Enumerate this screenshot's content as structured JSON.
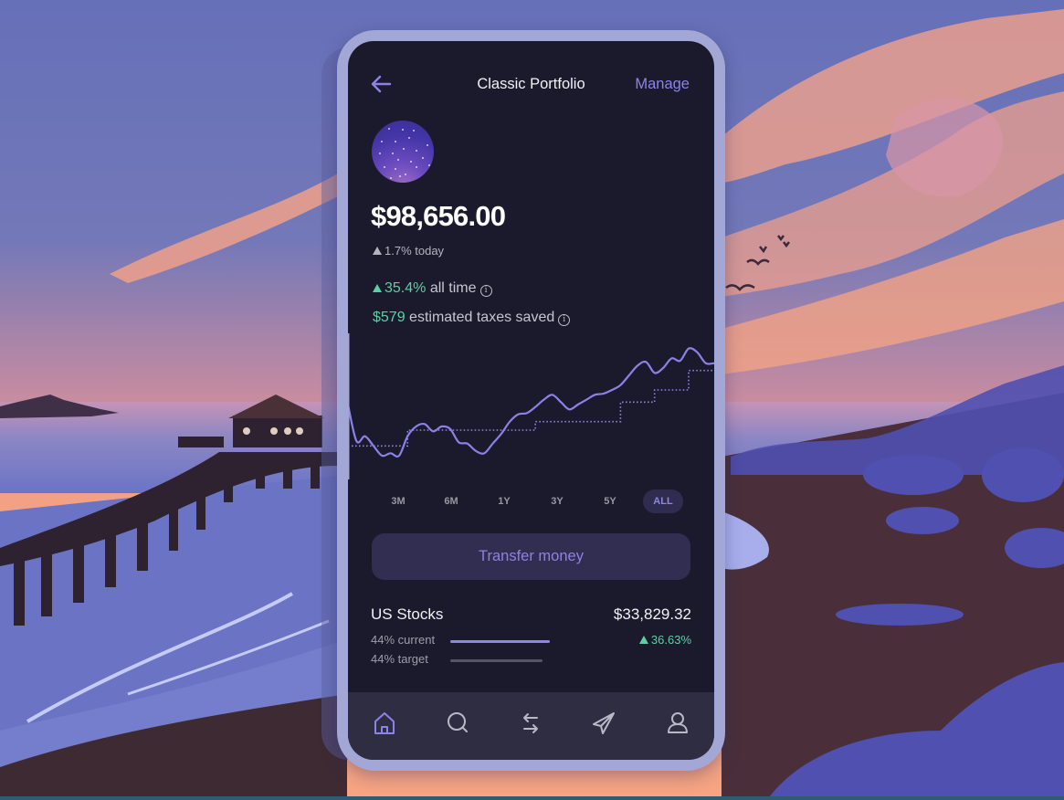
{
  "header": {
    "back_icon": "arrow-left-icon",
    "title": "Classic Portfolio",
    "manage_label": "Manage"
  },
  "portfolio": {
    "avatar": "starry-sky-avatar",
    "balance": "$98,656.00",
    "today_change": "1.7% today",
    "all_time_value": "35.4%",
    "all_time_label": "all time",
    "taxes_value": "$579",
    "taxes_label": "estimated taxes saved",
    "info_icon_glyph": "i"
  },
  "chart_data": {
    "type": "line",
    "title": "",
    "xlabel": "",
    "ylabel": "",
    "grid": false,
    "series": [
      {
        "name": "portfolio value",
        "style": "solid",
        "color": "#8a82e6",
        "values": [
          54,
          24,
          28,
          20,
          12,
          14,
          12,
          28,
          36,
          38,
          32,
          36,
          34,
          23,
          22,
          16,
          14,
          22,
          30,
          40,
          46,
          47,
          52,
          58,
          62,
          56,
          50,
          54,
          58,
          62,
          63,
          66,
          70,
          78,
          86,
          89,
          80,
          84,
          92,
          90,
          100,
          97,
          88,
          88
        ]
      },
      {
        "name": "deposits",
        "style": "dotted",
        "color": "#8a82e6",
        "values": [
          20,
          20,
          20,
          20,
          20,
          20,
          20,
          33,
          33,
          33,
          33,
          33,
          33,
          33,
          33,
          33,
          33,
          33,
          33,
          33,
          33,
          33,
          40,
          40,
          40,
          40,
          40,
          40,
          40,
          40,
          40,
          40,
          56,
          56,
          56,
          56,
          66,
          66,
          66,
          66,
          82,
          82,
          82,
          82
        ]
      }
    ],
    "ylim": [
      0,
      105
    ]
  },
  "ranges": {
    "items": [
      "3M",
      "6M",
      "1Y",
      "3Y",
      "5Y",
      "ALL"
    ],
    "active": "ALL"
  },
  "transfer_label": "Transfer money",
  "holding": {
    "name": "US Stocks",
    "value": "$33,829.32",
    "current_label": "44% current",
    "target_label": "44% target",
    "current_fraction": 0.44,
    "target_fraction": 0.44,
    "return": "36.63%"
  },
  "navbar": {
    "items": [
      {
        "name": "home",
        "icon": "home-icon",
        "active": true
      },
      {
        "name": "search",
        "icon": "search-icon",
        "active": false
      },
      {
        "name": "transfer",
        "icon": "transfer-arrows-icon",
        "active": false
      },
      {
        "name": "send",
        "icon": "paper-plane-icon",
        "active": false
      },
      {
        "name": "profile",
        "icon": "user-icon",
        "active": false
      }
    ]
  },
  "colors": {
    "accent": "#8c83ea",
    "positive": "#5ccfa5",
    "screen_bg": "#1b1a2c",
    "frame": "#a3a7d6"
  }
}
